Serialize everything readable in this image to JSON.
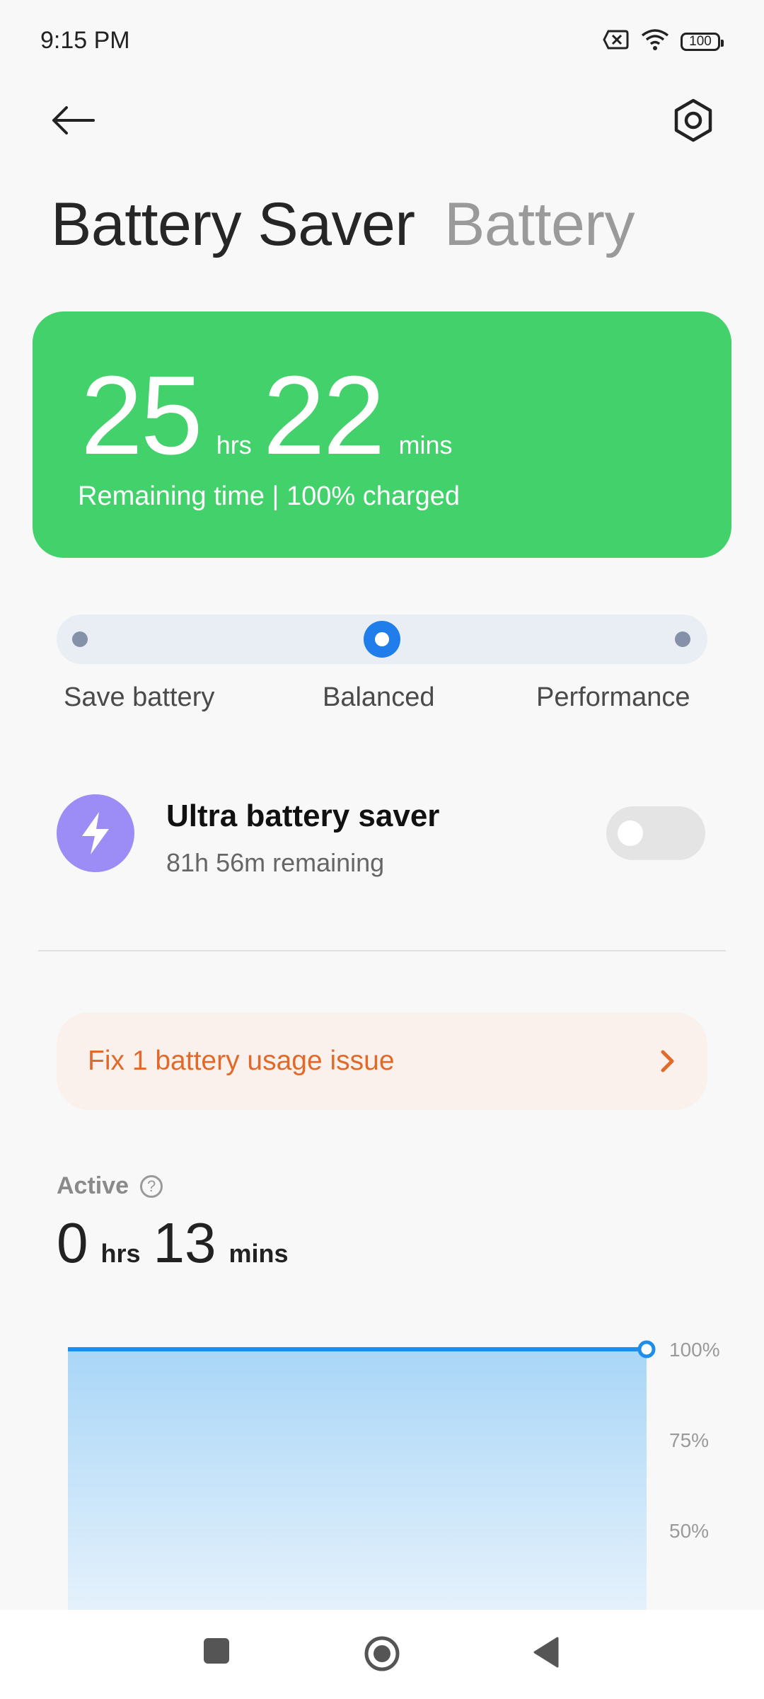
{
  "status": {
    "time": "9:15 PM",
    "battery": "100"
  },
  "header": {
    "tab_active": "Battery Saver",
    "tab_inactive": "Battery"
  },
  "card": {
    "hours": "25",
    "hours_unit": "hrs",
    "minutes": "22",
    "minutes_unit": "mins",
    "subtitle": "Remaining time | 100% charged",
    "color": "#42d16a"
  },
  "modes": {
    "items": [
      "Save battery",
      "Balanced",
      "Performance"
    ],
    "selected": "Balanced",
    "accent": "#1f7eea"
  },
  "ultra": {
    "title": "Ultra battery saver",
    "subtitle": "81h 56m remaining",
    "enabled": false,
    "icon": "bolt-icon"
  },
  "issue": {
    "label": "Fix 1 battery usage issue",
    "color": "#e16a2a"
  },
  "active": {
    "label": "Active",
    "hours": "0",
    "hours_unit": "hrs",
    "minutes": "13",
    "minutes_unit": "mins"
  },
  "chart_data": {
    "type": "area",
    "y_tick_labels": [
      "100%",
      "75%",
      "50%"
    ],
    "ylim": [
      0,
      100
    ],
    "series": [
      {
        "values": [
          100,
          100
        ]
      }
    ],
    "color": "#1f8ee8"
  }
}
